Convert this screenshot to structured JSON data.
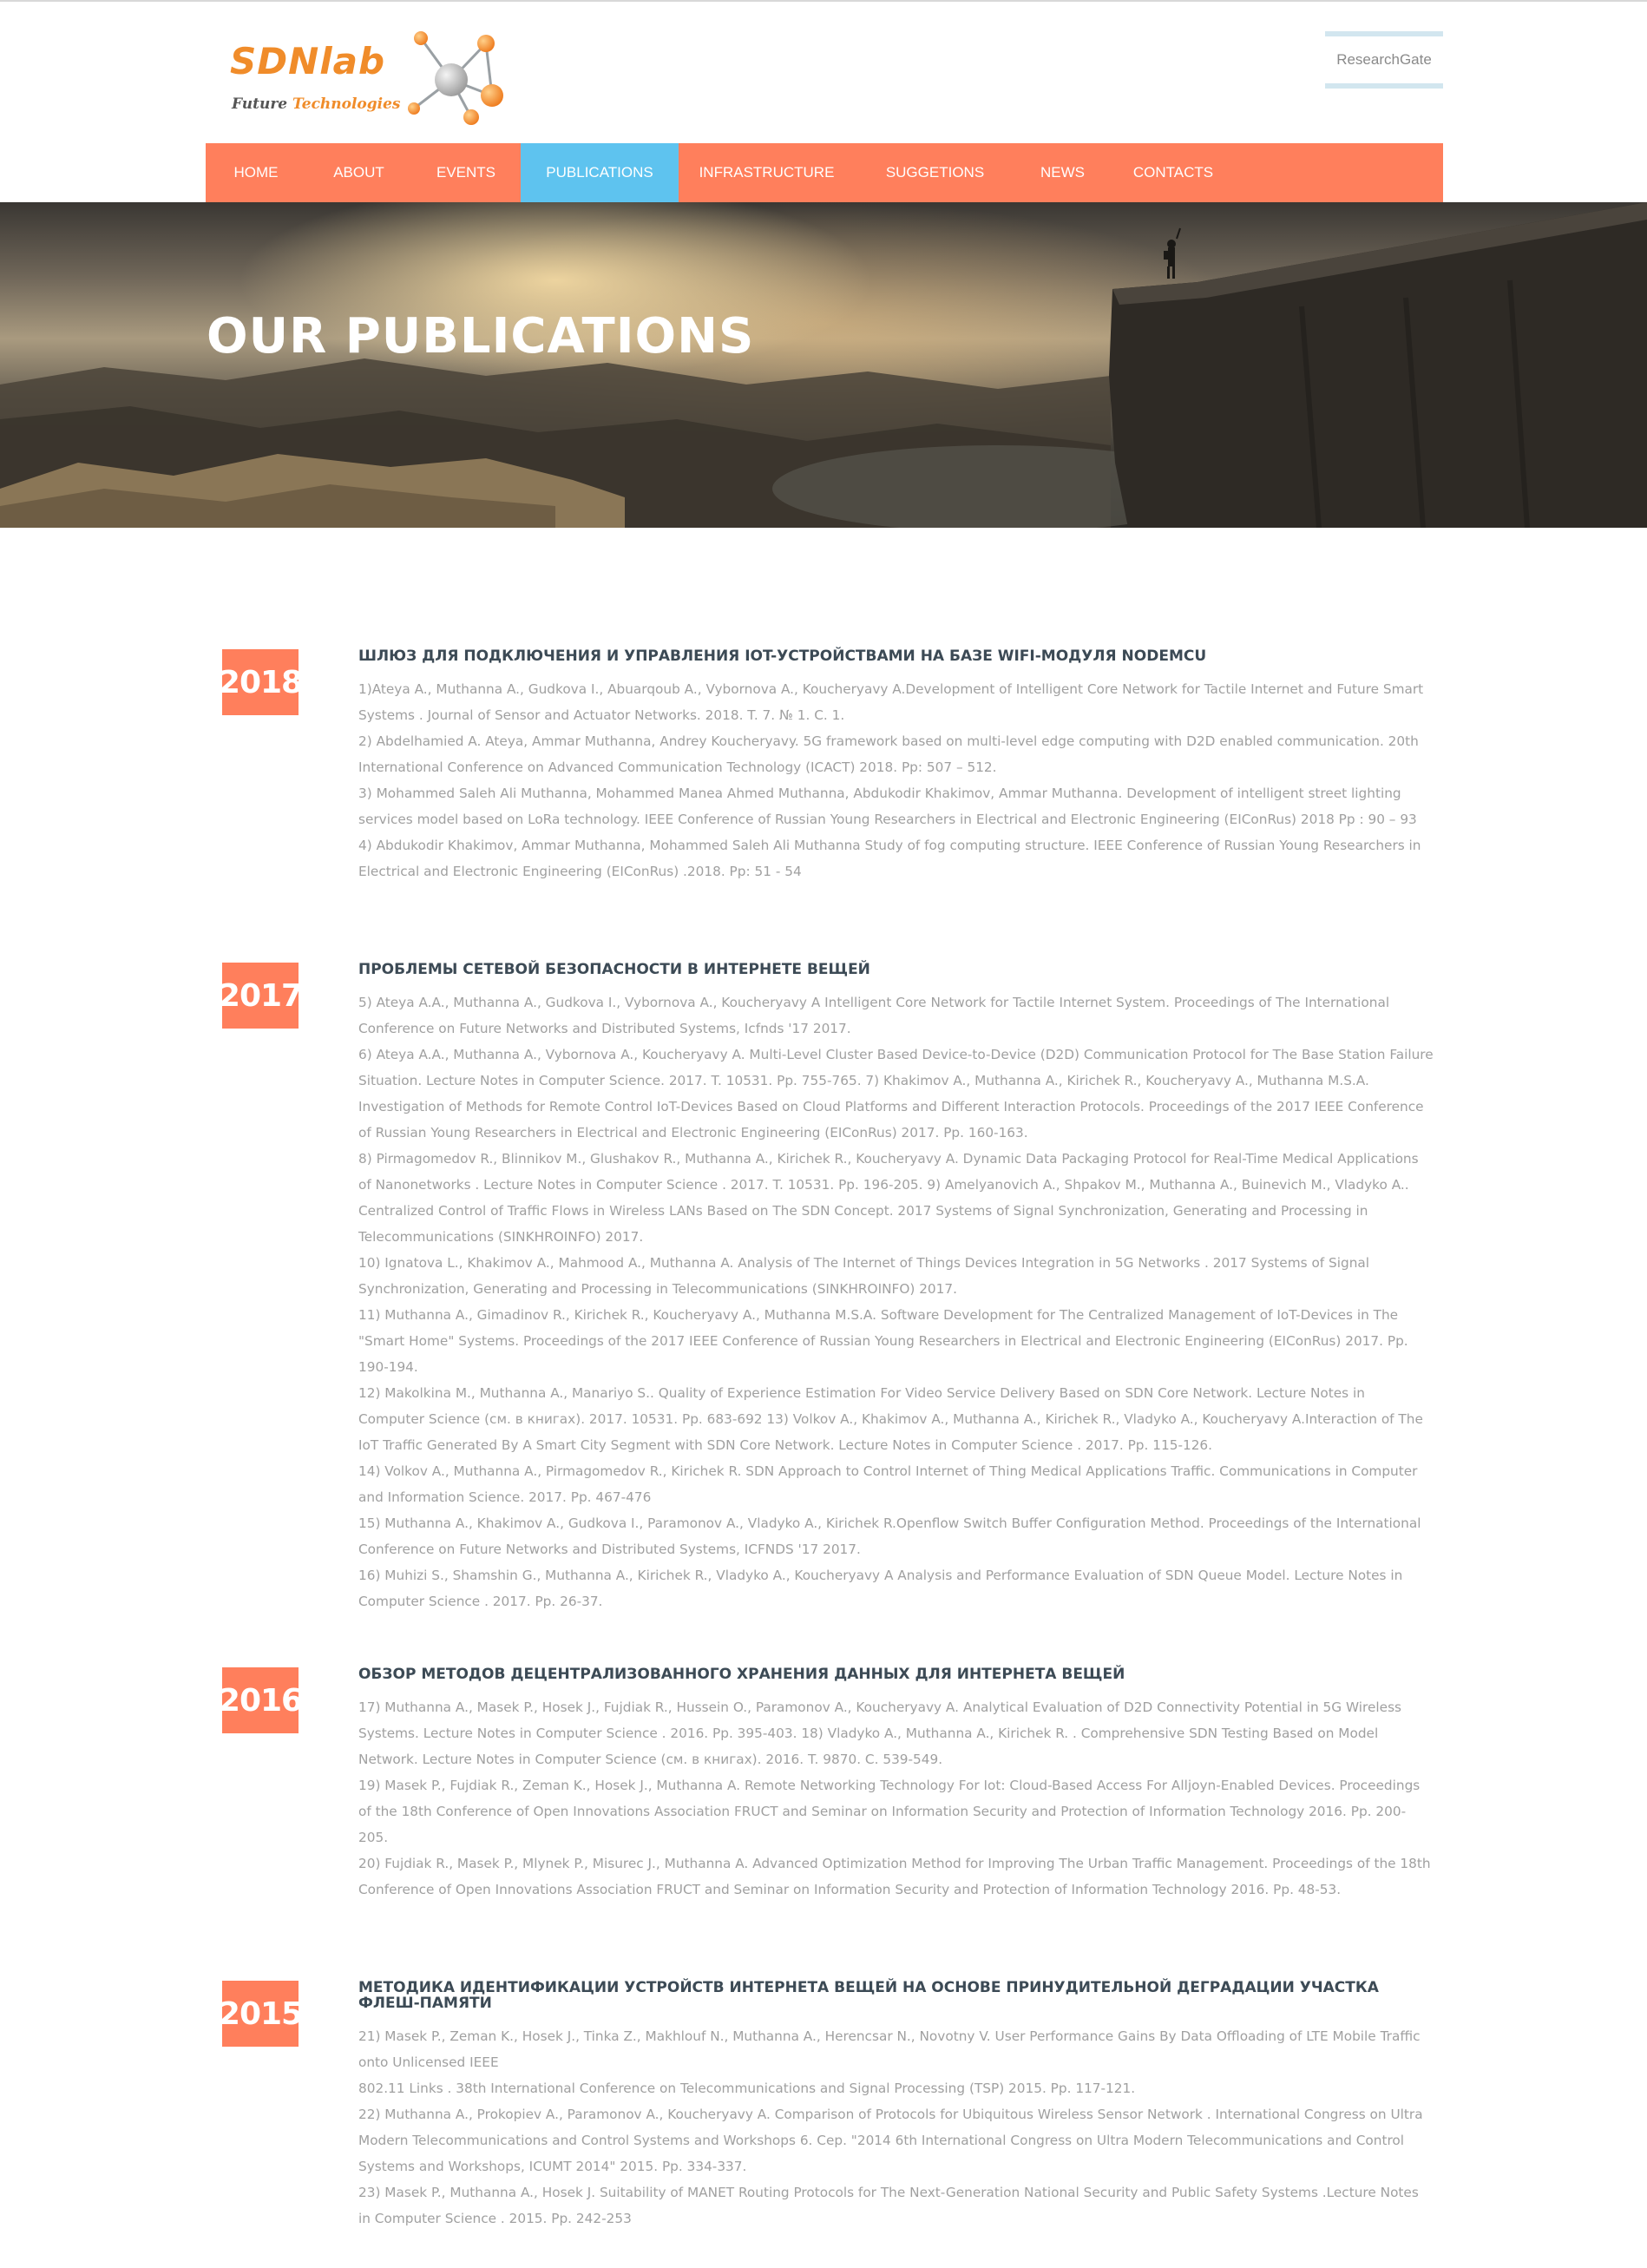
{
  "logo": {
    "name": "SDNlab",
    "tagline_part1": "Future ",
    "tagline_part2": "Technologies"
  },
  "header": {
    "researchgate_label": "ResearchGate"
  },
  "nav": {
    "items": [
      {
        "label": "HOME"
      },
      {
        "label": "ABOUT"
      },
      {
        "label": "EVENTS"
      },
      {
        "label": "PUBLICATIONS",
        "active": true
      },
      {
        "label": "INFRASTRUCTURE"
      },
      {
        "label": "SUGGETIONS"
      },
      {
        "label": "NEWS"
      },
      {
        "label": "CONTACTS"
      }
    ]
  },
  "hero": {
    "title": "OUR PUBLICATIONS"
  },
  "colors": {
    "accent": "#ff7f5c",
    "nav_active": "#5ec3ef",
    "title_text": "#3c4a55",
    "body_text": "#a0a0a0"
  },
  "publications": [
    {
      "year": "2018",
      "title": "Шлюз для подключения и управления IoT-устройствами на базе WiFi-модуля NodeMCU",
      "items": [
        "1)Ateya A., Muthanna A., Gudkova I., Abuarqoub A., Vybornova A., Koucheryavy A.Development of Intelligent Core Network for Tactile Internet and Future Smart Systems . Journal of Sensor and Actuator Networks. 2018. T. 7. № 1. C. 1.",
        "2) Abdelhamied A. Ateya, Ammar Muthanna, Andrey Koucheryavy. 5G framework based on multi-level edge computing with D2D enabled communication. 20th International Conference on Advanced Communication Technology (ICACT) 2018. Pp: 507 – 512.",
        "3) Mohammed Saleh Ali Muthanna, Mohammed Manea Ahmed Muthanna, Abdukodir Khakimov, Ammar Muthanna. Development of intelligent street lighting services model based on LoRa technology. IEEE Conference of Russian Young Researchers in Electrical and Electronic Engineering (EIConRus) 2018 Pp : 90 – 93",
        "4) Abdukodir Khakimov, Ammar Muthanna, Mohammed Saleh Ali Muthanna Study of fog computing structure. IEEE Conference of Russian Young Researchers in Electrical and Electronic Engineering (EIConRus) .2018. Pp: 51 - 54"
      ]
    },
    {
      "year": "2017",
      "title": "Проблемы сетевой безопасности в Интернете вещей",
      "items": [
        "5) Ateya A.A., Muthanna A., Gudkova I., Vybornova A., Koucheryavy A Intelligent Core Network for Tactile Internet System. Proceedings of The International Conference on Future Networks and Distributed Systems, Icfnds '17 2017.",
        "6) Ateya A.A., Muthanna A., Vybornova A., Koucheryavy A. Multi-Level Cluster Based Device-to-Device (D2D) Communication Protocol for The Base Station Failure Situation. Lecture Notes in Computer Science. 2017. T. 10531. Pp. 755-765. 7) Khakimov A., Muthanna A., Kirichek R., Koucheryavy A., Muthanna M.S.A. Investigation of Methods for Remote Control IoT-Devices Based on Cloud Platforms and Different Interaction Protocols. Proceedings of the 2017 IEEE Conference of Russian Young Researchers in Electrical and Electronic Engineering (EIConRus) 2017. Pp. 160-163.",
        "8) Pirmagomedov R., Blinnikov M., Glushakov R., Muthanna A., Kirichek R., Koucheryavy A. Dynamic Data Packaging Protocol for Real-Time Medical Applications of Nanonetworks . Lecture Notes in Computer Science . 2017. T. 10531. Pp. 196-205. 9) Amelyanovich A., Shpakov M., Muthanna A., Buinevich M., Vladyko A.. Centralized Control of Traffic Flows in Wireless LANs Based on The SDN Concept. 2017 Systems of Signal Synchronization, Generating and Processing in Telecommunications (SINKHROINFO) 2017.",
        "10) Ignatova L., Khakimov A., Mahmood A., Muthanna A. Analysis of The Internet of Things Devices Integration in 5G Networks . 2017 Systems of Signal Synchronization, Generating and Processing in Telecommunications (SINKHROINFO) 2017.",
        "11) Muthanna A., Gimadinov R., Kirichek R., Koucheryavy A., Muthanna M.S.A. Software Development for The Centralized Management of IoT-Devices in The \"Smart Home\" Systems. Proceedings of the 2017 IEEE Conference of Russian Young Researchers in Electrical and Electronic Engineering (EIConRus) 2017. Pp. 190-194.",
        "12) Makolkina M., Muthanna A., Manariyo S.. Quality of Experience Estimation For Video Service Delivery Based on SDN Core Network. Lecture Notes in Computer Science (см. в книгах). 2017. 10531. Pp. 683-692 13) Volkov A., Khakimov A., Muthanna A., Kirichek R., Vladyko A., Koucheryavy A.Interaction of The IoT Traffic Generated By A Smart City Segment with SDN Core Network. Lecture Notes in Computer Science . 2017. Pp. 115-126.",
        "14) Volkov A., Muthanna A., Pirmagomedov R., Kirichek R. SDN Approach to Control Internet of Thing Medical Applications Traffic. Communications in Computer and Information Science. 2017. Pp. 467-476",
        "15) Muthanna A., Khakimov A., Gudkova I., Paramonov A., Vladyko A., Kirichek R.Openflow Switch Buffer Configuration Method. Proceedings of the International Conference on Future Networks and Distributed Systems, ICFNDS '17 2017.",
        "16) Muhizi S., Shamshin G., Muthanna A., Kirichek R., Vladyko A., Koucheryavy A Analysis and Performance Evaluation of SDN Queue Model. Lecture Notes in Computer Science . 2017. Pp. 26-37."
      ]
    },
    {
      "year": "2016",
      "title": "Обзор методов децентрализованного хранения данных для Интернета вещей",
      "items": [
        "17) Muthanna A., Masek P., Hosek J., Fujdiak R., Hussein O., Paramonov A., Koucheryavy A. Analytical Evaluation of D2D Connectivity Potential in 5G Wireless Systems. Lecture Notes in Computer Science . 2016. Pp. 395-403. 18) Vladyko A., Muthanna A., Kirichek R. . Comprehensive SDN Testing Based on Model Network. Lecture Notes in Computer Science (см. в книгах). 2016. T. 9870. C. 539-549.",
        "19) Masek P., Fujdiak R., Zeman K., Hosek J., Muthanna A. Remote Networking Technology For Iot: Cloud-Based Access For Alljoyn-Enabled Devices. Proceedings of the 18th Conference of Open Innovations Association FRUCT and Seminar on Information Security and Protection of Information Technology 2016. Pp. 200-205.",
        "20) Fujdiak R., Masek P., Mlynek P., Misurec J., Muthanna A. Advanced Optimization Method for Improving The Urban Traffic Management. Proceedings of the 18th Conference of Open Innovations Association FRUCT and Seminar on Information Security and Protection of Information Technology 2016. Pp. 48-53."
      ]
    },
    {
      "year": "2015",
      "title": "Методика идентификации устройств Интернета вещей на основе принудительной деградации участка флеш-памяти",
      "items": [
        "21) Masek P., Zeman K., Hosek J., Tinka Z., Makhlouf N., Muthanna A., Herencsar N., Novotny V. User Performance Gains By Data Offloading of LTE Mobile Traffic onto Unlicensed IEEE",
        "802.11 Links . 38th International Conference on Telecommunications and Signal Processing (TSP) 2015. Pp. 117-121.",
        "22) Muthanna A., Prokopiev A., Paramonov A., Koucheryavy A. Comparison of Protocols for Ubiquitous Wireless Sensor Network . International Congress on Ultra Modern Telecommunications and Control Systems and Workshops 6. Сер. \"2014 6th International Congress on Ultra Modern Telecommunications and Control Systems and Workshops, ICUMT 2014\" 2015. Pp. 334-337.",
        "23) Masek P., Muthanna A., Hosek J. Suitability of MANET Routing Protocols for The Next-Generation National Security and Public Safety Systems .Lecture Notes in Computer Science . 2015. Pp. 242-253"
      ]
    }
  ]
}
